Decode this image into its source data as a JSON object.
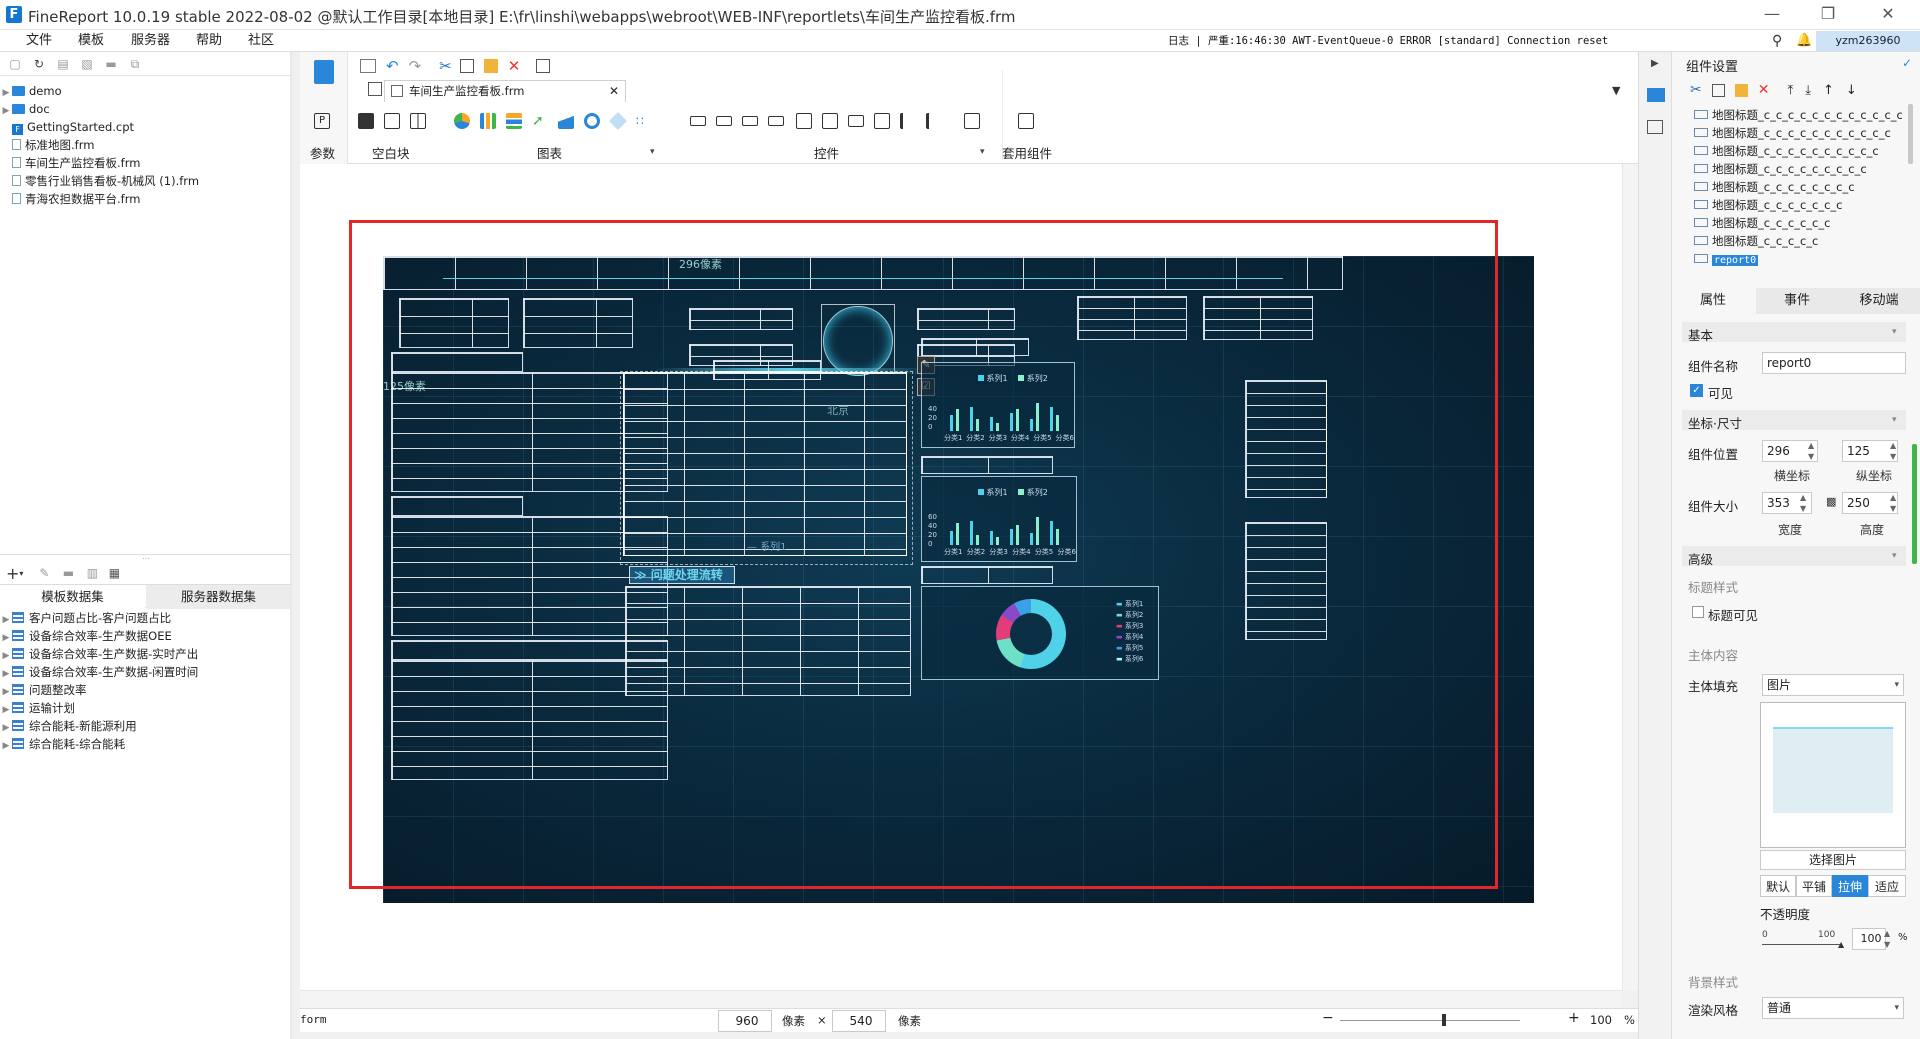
{
  "window": {
    "title": "FineReport 10.0.19 stable 2022-08-02 @默认工作目录[本地目录]   E:\\fr\\linshi\\webapps\\webroot\\WEB-INF\\reportlets\\车间生产监控看板.frm"
  },
  "menu": [
    "文件",
    "模板",
    "服务器",
    "帮助",
    "社区"
  ],
  "log_line": "日志 | 严重:16:46:30 AWT-EventQueue-0 ERROR [standard] Connection reset",
  "user": "yzm263960",
  "file_tree": [
    {
      "name": "demo",
      "type": "folder"
    },
    {
      "name": "doc",
      "type": "folder"
    },
    {
      "name": "GettingStarted.cpt",
      "type": "cpt"
    },
    {
      "name": "标准地图.frm",
      "type": "file"
    },
    {
      "name": "车间生产监控看板.frm",
      "type": "file"
    },
    {
      "name": "零售行业销售看板-机械风 (1).frm",
      "type": "file"
    },
    {
      "name": "青海农担数据平台.frm",
      "type": "file"
    }
  ],
  "dataset_tabs": [
    "模板数据集",
    "服务器数据集"
  ],
  "datasets": [
    "客户问题占比-客户问题占比",
    "设备综合效率-生产数据OEE",
    "设备综合效率-生产数据-实时产出",
    "设备综合效率-生产数据-闲置时间",
    "问题整改率",
    "运输计划",
    "综合能耗-新能源利用",
    "综合能耗-综合能耗"
  ],
  "doc_tab": "车间生产监控看板.frm",
  "ribbon_groups": [
    "参数",
    "空白块",
    "图表",
    "控件",
    "套用组件"
  ],
  "canvas": {
    "label_top": "296像素",
    "label_left": "125像素",
    "label_map": "北京",
    "legend_series1": "系列1",
    "flow_title": "问题处理流转",
    "bar_legend": [
      "系列1",
      "系列2"
    ],
    "bar_categories": [
      "分类1",
      "分类2",
      "分类3",
      "分类4",
      "分类5",
      "分类6"
    ],
    "bar_axis": [
      "60",
      "40",
      "20",
      "0"
    ],
    "donut_legend": [
      "系列1",
      "系列2",
      "系列3",
      "系列4",
      "系列5",
      "系列6"
    ]
  },
  "status": {
    "mode": "form",
    "width": "960",
    "width_unit": "像素",
    "x": "×",
    "height": "540",
    "height_unit": "像素",
    "zoom": "100",
    "pct": "%"
  },
  "right": {
    "title": "组件设置",
    "components": [
      "地图标题_c_c_c_c_c_c_c_c_c_c_c_c",
      "地图标题_c_c_c_c_c_c_c_c_c_c_c",
      "地图标题_c_c_c_c_c_c_c_c_c_c",
      "地图标题_c_c_c_c_c_c_c_c_c",
      "地图标题_c_c_c_c_c_c_c_c",
      "地图标题_c_c_c_c_c_c_c",
      "地图标题_c_c_c_c_c_c",
      "地图标题_c_c_c_c_c",
      "report0"
    ],
    "tabs": [
      "属性",
      "事件",
      "移动端"
    ],
    "basic": "基本",
    "name_label": "组件名称",
    "name_value": "report0",
    "visible_label": "可见",
    "coord_section": "坐标·尺寸",
    "pos_label": "组件位置",
    "pos_x": "296",
    "pos_y": "125",
    "x_caption": "横坐标",
    "y_caption": "纵坐标",
    "size_label": "组件大小",
    "width": "353",
    "height": "250",
    "w_caption": "宽度",
    "h_caption": "高度",
    "advanced": "高级",
    "title_style": "标题样式",
    "title_visible": "标题可见",
    "body_content": "主体内容",
    "body_fill_label": "主体填充",
    "body_fill_value": "图片",
    "choose_image": "选择图片",
    "image_modes": [
      "默认",
      "平铺",
      "拉伸",
      "适应"
    ],
    "opacity_label": "不透明度",
    "opacity_min": "0",
    "opacity_max": "100",
    "opacity_value": "100",
    "opacity_unit": "%",
    "bg_style": "背景样式",
    "render_label": "渲染风格",
    "render_value": "普通"
  }
}
